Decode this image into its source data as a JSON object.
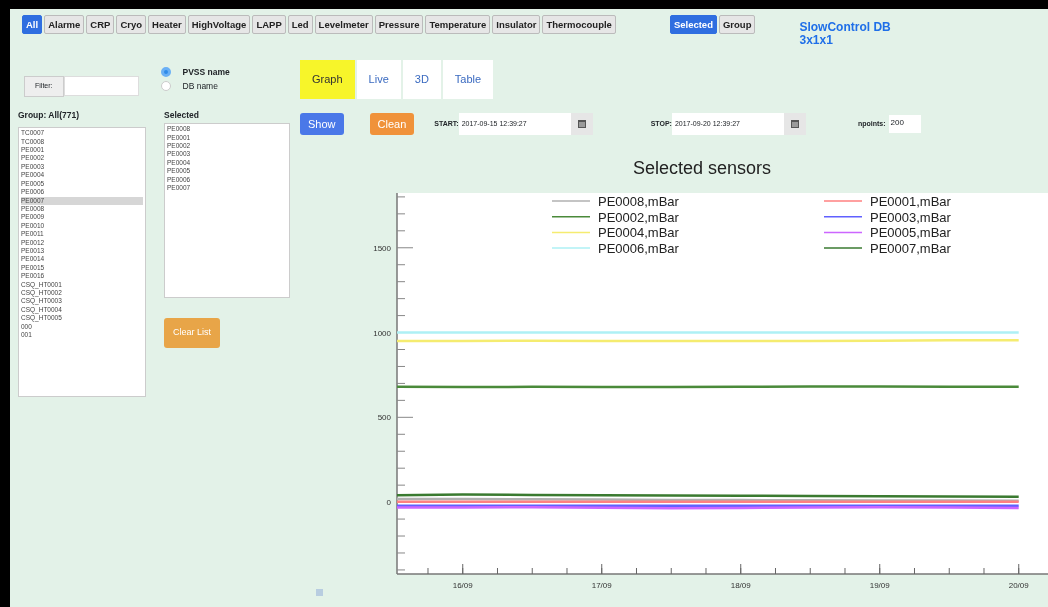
{
  "top_bar": {
    "categories": [
      {
        "label": "All",
        "selected": true
      },
      {
        "label": "Alarme",
        "selected": false
      },
      {
        "label": "CRP",
        "selected": false
      },
      {
        "label": "Cryo",
        "selected": false
      },
      {
        "label": "Heater",
        "selected": false
      },
      {
        "label": "HighVoltage",
        "selected": false
      },
      {
        "label": "LAPP",
        "selected": false
      },
      {
        "label": "Led",
        "selected": false
      },
      {
        "label": "Levelmeter",
        "selected": false
      },
      {
        "label": "Pressure",
        "selected": false
      },
      {
        "label": "Temperature",
        "selected": false
      },
      {
        "label": "Insulator",
        "selected": false
      },
      {
        "label": "Thermocouple",
        "selected": false
      }
    ],
    "modes": [
      {
        "label": "Selected",
        "selected": true
      },
      {
        "label": "Group",
        "selected": false
      }
    ],
    "title": "SlowControl DB 3x1x1"
  },
  "left_panel": {
    "filter_label": "Filter:",
    "name_options": [
      {
        "label": "PVSS name",
        "selected": true
      },
      {
        "label": "DB name",
        "selected": false
      }
    ],
    "group_heading": "Group: All(771)",
    "group_items": [
      {
        "label": "TC0007",
        "selected": false
      },
      {
        "label": "TC0008",
        "selected": false
      },
      {
        "label": "PE0001",
        "selected": false
      },
      {
        "label": "PE0002",
        "selected": false
      },
      {
        "label": "PE0003",
        "selected": false
      },
      {
        "label": "PE0004",
        "selected": false
      },
      {
        "label": "PE0005",
        "selected": false
      },
      {
        "label": "PE0006",
        "selected": false
      },
      {
        "label": "PE0007",
        "selected": true
      },
      {
        "label": "PE0008",
        "selected": false
      },
      {
        "label": "PE0009",
        "selected": false
      },
      {
        "label": "PE0010",
        "selected": false
      },
      {
        "label": "PE0011",
        "selected": false
      },
      {
        "label": "PE0012",
        "selected": false
      },
      {
        "label": "PE0013",
        "selected": false
      },
      {
        "label": "PE0014",
        "selected": false
      },
      {
        "label": "PE0015",
        "selected": false
      },
      {
        "label": "PE0016",
        "selected": false
      },
      {
        "label": "CSQ_HT0001",
        "selected": false
      },
      {
        "label": "CSQ_HT0002",
        "selected": false
      },
      {
        "label": "CSQ_HT0003",
        "selected": false
      },
      {
        "label": "CSQ_HT0004",
        "selected": false
      },
      {
        "label": "CSQ_HT0005",
        "selected": false
      },
      {
        "label": "000",
        "selected": false
      },
      {
        "label": "001",
        "selected": false
      }
    ],
    "selected_heading": "Selected",
    "selected_items": [
      "PE0008",
      "PE0001",
      "PE0002",
      "PE0003",
      "PE0004",
      "PE0005",
      "PE0006",
      "PE0007"
    ],
    "clear_button": "Clear List"
  },
  "tabs": [
    {
      "label": "Graph",
      "selected": true
    },
    {
      "label": "Live",
      "selected": false
    },
    {
      "label": "3D",
      "selected": false
    },
    {
      "label": "Table",
      "selected": false
    }
  ],
  "controls": {
    "show_button": "Show",
    "clean_button": "Clean",
    "start_label": "START:",
    "start_value": "2017-09-15 12:39:27",
    "stop_label": "STOP:",
    "stop_value": "2017-09-20 12:39:27",
    "npoints_label": "npoints:",
    "npoints_value": "200"
  },
  "chart": {
    "chart_data": {
      "type": "line",
      "title": "Selected sensors",
      "categories": [
        null,
        "16/09",
        null,
        "17/09",
        null,
        "18/09",
        null,
        "19/09",
        null,
        "20/09",
        null
      ],
      "ylim": [
        -424,
        1823
      ],
      "legend": "upper center",
      "yticks": [
        0,
        500,
        1000,
        1500
      ],
      "series": [
        {
          "name": "PE0008,mBar",
          "color": "#b0b0b0",
          "values": [
            18,
            18,
            17,
            15,
            13,
            12,
            11,
            10,
            9,
            8,
            null
          ]
        },
        {
          "name": "PE0001,mBar",
          "color": "#ff8080",
          "values": [
            2,
            2,
            2,
            2,
            2,
            2,
            2,
            2,
            2,
            2,
            null
          ]
        },
        {
          "name": "PE0002,mBar",
          "color": "#4a8a3a",
          "values": [
            680,
            678,
            680,
            679,
            678,
            680,
            681,
            682,
            680,
            680,
            null
          ]
        },
        {
          "name": "PE0003,mBar",
          "color": "#6060ff",
          "values": [
            -22,
            -22,
            -22,
            -22,
            -22,
            -22,
            -22,
            -22,
            -22,
            -22,
            null
          ]
        },
        {
          "name": "PE0004,mBar",
          "color": "#f5ec70",
          "values": [
            950,
            951,
            952,
            951,
            950,
            950,
            951,
            952,
            954,
            955,
            null
          ]
        },
        {
          "name": "PE0005,mBar",
          "color": "#cc66ff",
          "values": [
            -32,
            -31,
            -30,
            -33,
            -36,
            -34,
            -32,
            -30,
            -32,
            -34,
            null
          ]
        },
        {
          "name": "PE0006,mBar",
          "color": "#aef0f5",
          "values": [
            1000,
            1000,
            1000,
            1000,
            1000,
            1000,
            1000,
            1000,
            1000,
            1000,
            null
          ]
        },
        {
          "name": "PE0007,mBar",
          "color": "#3a7a30",
          "values": [
            40,
            45,
            42,
            40,
            39,
            38,
            36,
            35,
            33,
            32,
            null
          ]
        }
      ]
    }
  }
}
